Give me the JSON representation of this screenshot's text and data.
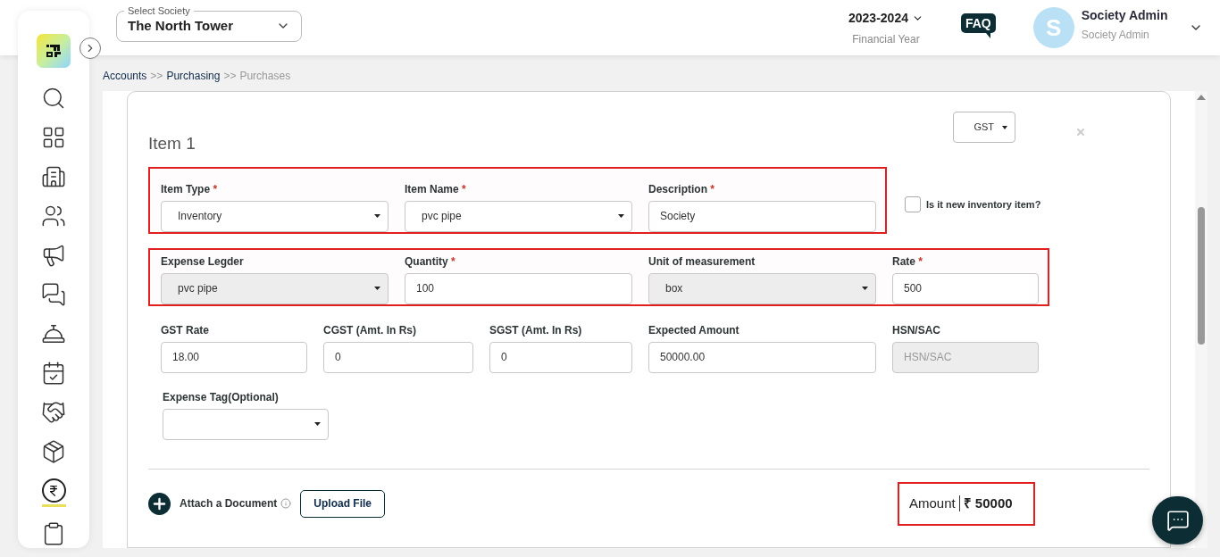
{
  "header": {
    "society_select": {
      "label": "Select Society",
      "value": "The North Tower"
    },
    "financial_year": {
      "value": "2023-2024",
      "label": "Financial Year"
    },
    "faq": "FAQ",
    "user": {
      "initial": "S",
      "name": "Society Admin",
      "role": "Society Admin"
    }
  },
  "sidebar": {
    "items": [
      {
        "selected": false
      },
      {
        "selected": false
      },
      {
        "selected": false
      },
      {
        "selected": false
      },
      {
        "selected": false
      },
      {
        "selected": false
      },
      {
        "selected": false
      },
      {
        "selected": false
      },
      {
        "selected": false
      },
      {
        "selected": false
      },
      {
        "selected": true
      },
      {
        "selected": false
      }
    ]
  },
  "breadcrumb": [
    {
      "label": "Accounts",
      "current": false
    },
    {
      "separator": ">>",
      "label": "Purchasing",
      "current": false
    },
    {
      "separator": ">>",
      "label": "Purchases",
      "current": true
    }
  ],
  "item": {
    "title": "Item 1",
    "tax_type": "GST",
    "rows": [
      {
        "highlighted": true,
        "fields": [
          {
            "kind": "select",
            "label": "Item Type",
            "required_mark": "*",
            "disabled": false,
            "value": "Inventory"
          },
          {
            "kind": "select",
            "label": "Item Name",
            "required_mark": "*",
            "disabled": false,
            "value": "pvc pipe"
          },
          {
            "kind": "input",
            "label": "Description",
            "required_mark": "*",
            "disabled": false,
            "value": "Society"
          }
        ]
      },
      {
        "highlighted": true,
        "fields": [
          {
            "kind": "select",
            "label": "Expense Legder",
            "disabled": true,
            "value": "pvc pipe"
          },
          {
            "kind": "input",
            "label": "Quantity",
            "required_mark": "*",
            "disabled": false,
            "value": "100"
          },
          {
            "kind": "select",
            "label": "Unit of measurement",
            "disabled": true,
            "value": "box"
          },
          {
            "kind": "input",
            "label": "Rate",
            "required_mark": "*",
            "disabled": false,
            "value": "500"
          }
        ]
      },
      {
        "highlighted": false,
        "fields": [
          {
            "kind": "input",
            "label": "GST Rate",
            "disabled": false,
            "value": "18.00"
          },
          {
            "kind": "input",
            "label": "CGST (Amt. In Rs)",
            "disabled": false,
            "value": "0"
          },
          {
            "kind": "input",
            "label": "SGST (Amt. In Rs)",
            "disabled": false,
            "value": "0"
          },
          {
            "kind": "input",
            "label": "Expected Amount",
            "disabled": false,
            "value": "50000.00"
          },
          {
            "kind": "input",
            "label": "HSN/SAC",
            "disabled": true,
            "placeholder": "HSN/SAC"
          }
        ]
      },
      {
        "highlighted": false,
        "fields": [
          {
            "kind": "select",
            "label": "Expense Tag(Optional)",
            "disabled": false
          }
        ]
      }
    ],
    "new_item_checkbox": {
      "label": "Is it new inventory item?",
      "checked": false
    },
    "attach_label": "Attach a Document",
    "upload_button": "Upload File",
    "amount": {
      "label": "Amount",
      "value": "₹ 50000",
      "highlighted": true
    }
  }
}
